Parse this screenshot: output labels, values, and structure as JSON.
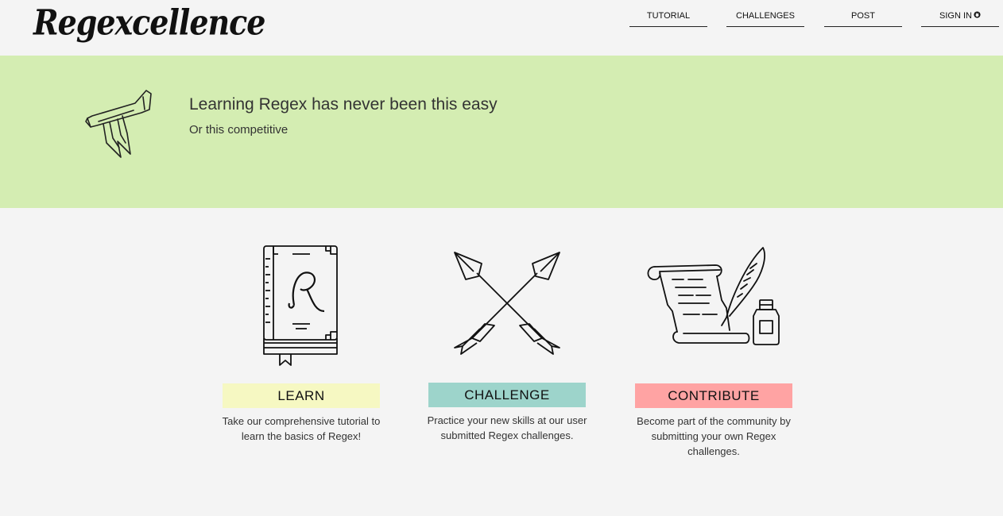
{
  "brand": {
    "logo_text": "Regexcellence"
  },
  "nav": {
    "items": [
      {
        "label": "TUTORIAL"
      },
      {
        "label": "CHALLENGES"
      },
      {
        "label": "POST"
      },
      {
        "label": "SIGN IN"
      }
    ],
    "signin_icon": "github-icon"
  },
  "hero": {
    "icon": "horn-icon",
    "title": "Learning Regex has never been this easy",
    "subtitle": "Or this competitive"
  },
  "cards": [
    {
      "icon": "book-icon",
      "button_label": "LEARN",
      "button_color": "#f6f8c2",
      "description": "Take our comprehensive tutorial to learn the basics of Regex!"
    },
    {
      "icon": "crossed-arrows-icon",
      "button_label": "CHALLENGE",
      "button_color": "#9dd4cb",
      "description": "Practice your new skills at our user submitted Regex challenges."
    },
    {
      "icon": "scroll-quill-icon",
      "button_label": "CONTRIBUTE",
      "button_color": "#ffa3a3",
      "description": "Become part of the community by submitting your own Regex challenges."
    }
  ],
  "colors": {
    "hero_bg": "#d4edb2",
    "page_bg": "#f4f4f4"
  }
}
